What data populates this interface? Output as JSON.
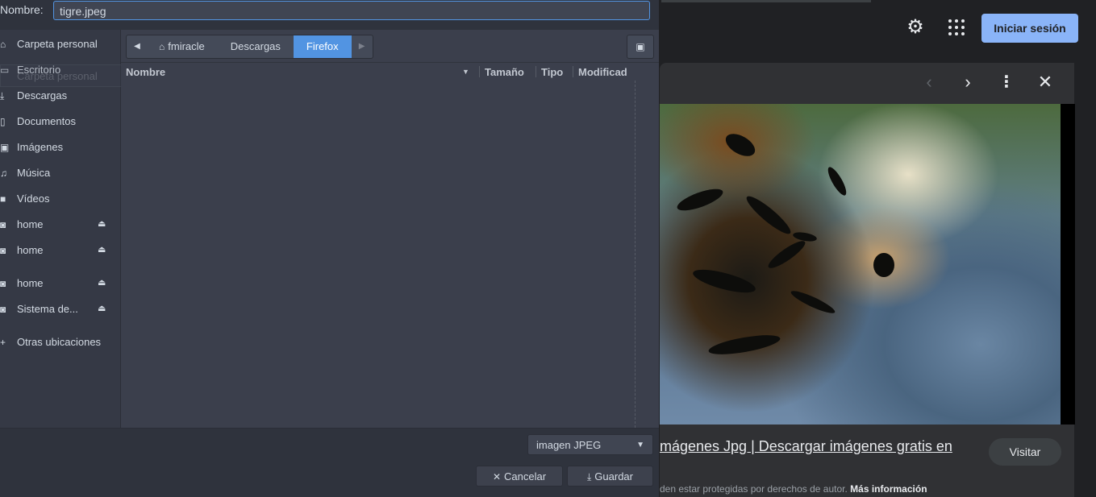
{
  "background": {
    "login_label": "Iniciar sesión",
    "settings_icon": "gear-icon",
    "apps_icon": "apps-grid-icon",
    "result_title": "mágenes Jpg | Descargar imágenes gratis en",
    "visit_label": "Visitar",
    "rights_text": "den estar protegidas por derechos de autor.",
    "rights_link": "Más información",
    "colors": {
      "accent": "#8ab4f8",
      "surface": "#303134",
      "page": "#202124"
    }
  },
  "dialog": {
    "name_label": "Nombre:",
    "name_value": "tigre.jpeg",
    "ghost_label": "Carpeta personal",
    "sidebar": [
      {
        "label": "Carpeta personal",
        "icon": "home-icon",
        "eject": false
      },
      {
        "label": "Escritorio",
        "icon": "desktop-icon",
        "eject": false
      },
      {
        "label": "Descargas",
        "icon": "download-icon",
        "eject": false
      },
      {
        "label": "Documentos",
        "icon": "document-icon",
        "eject": false
      },
      {
        "label": "Imágenes",
        "icon": "image-icon",
        "eject": false
      },
      {
        "label": "Música",
        "icon": "music-icon",
        "eject": false
      },
      {
        "label": "Vídeos",
        "icon": "video-icon",
        "eject": false
      },
      {
        "label": "home",
        "icon": "drive-icon",
        "eject": true
      },
      {
        "label": "home",
        "icon": "drive-icon",
        "eject": true
      },
      {
        "label": "home",
        "icon": "drive-icon",
        "eject": true
      },
      {
        "label": "Sistema de...",
        "icon": "drive-icon",
        "eject": true
      },
      {
        "label": "Otras ubicaciones",
        "icon": "plus-icon",
        "eject": false
      }
    ],
    "path": [
      "fmiracle",
      "Descargas",
      "Firefox"
    ],
    "active_path": "Firefox",
    "columns": [
      "Nombre",
      "Tamaño",
      "Tipo",
      "Modificad"
    ],
    "filter": "imagen JPEG",
    "cancel_label": "Cancelar",
    "save_label": "Guardar",
    "colors": {
      "accent": "#5294e2",
      "base": "#353945",
      "view": "#3b3f4c"
    }
  }
}
